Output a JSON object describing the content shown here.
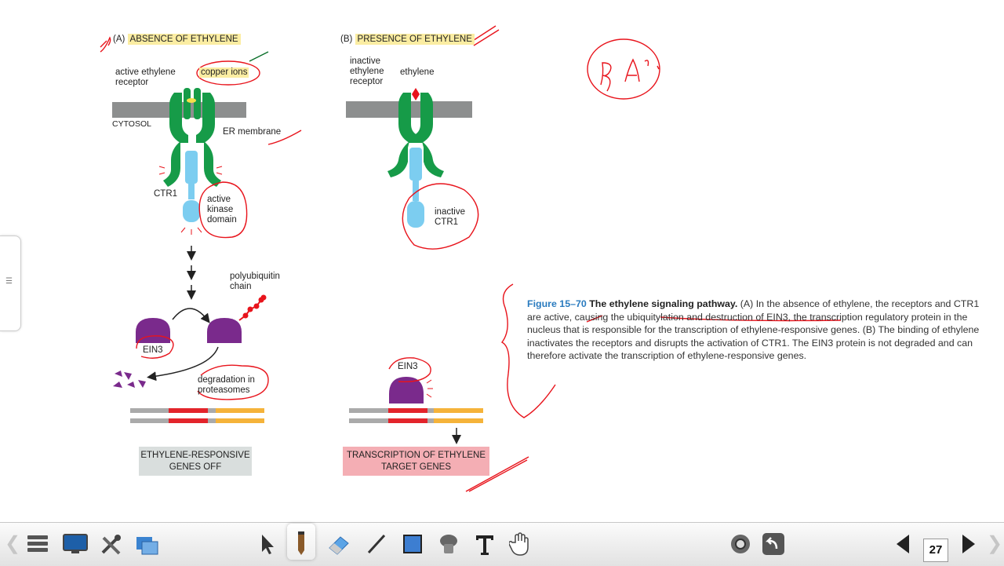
{
  "panel_a": {
    "header_letter": "(A)",
    "header": "ABSENCE OF ETHYLENE",
    "receptor_label": "active ethylene receptor",
    "copper_label": "copper ions",
    "cytosol_label": "CYTOSOL",
    "er_label": "ER membrane",
    "ctr1_label": "CTR1",
    "kinase_label": "active kinase domain",
    "polyub_label": "polyubiquitin chain",
    "ein3_label": "EIN3",
    "degradation_label": "degradation in proteasomes",
    "result_box": "ETHYLENE-RESPONSIVE GENES OFF"
  },
  "panel_b": {
    "header_letter": "(B)",
    "header": "PRESENCE OF ETHYLENE",
    "receptor_label": "inactive ethylene receptor",
    "ethylene_label": "ethylene",
    "ctr1_label": "inactive CTR1",
    "ein3_label": "EIN3",
    "result_box": "TRANSCRIPTION OF ETHYLENE TARGET GENES"
  },
  "caption": {
    "figure_no": "Figure 15–70",
    "title": "The ethylene signaling pathway.",
    "text": "(A) In the absence of ethylene, the receptors and CTR1 are active, causing the ubiquitylation and destruction of EIN3, the transcription regulatory protein in the nucleus that is responsible for the transcription of ethylene-responsive genes. (B) The binding of ethylene inactivates the receptors and disrupts the activation of CTR1. The EIN3 protein is not degraded and can therefore activate the transcription of ethylene-responsive genes."
  },
  "annotation_handwriting": "P2 A?",
  "toolbar": {
    "page_number": "27",
    "left_tools": [
      "menu-icon",
      "screen-icon",
      "tools-icon",
      "share-icon"
    ],
    "draw_tools": [
      "select-arrow-icon",
      "pencil-icon",
      "eraser-icon",
      "line-icon",
      "rectangle-icon",
      "fill-icon",
      "text-icon",
      "hand-icon"
    ],
    "right_tools": [
      "camera-icon",
      "undo-icon"
    ]
  },
  "colors": {
    "receptor_green": "#169b48",
    "ctr1_blue": "#7ccdf0",
    "ein3_purple": "#7a2a8c",
    "membrane_gray": "#8d8f8f",
    "ink_red": "#e8141c",
    "header_highlight": "#fbeda2",
    "gene_red": "#e3242b",
    "gene_orange": "#f5b33a",
    "result_gray_box": "#d9dedd",
    "result_pink_box": "#f4aeb4"
  }
}
